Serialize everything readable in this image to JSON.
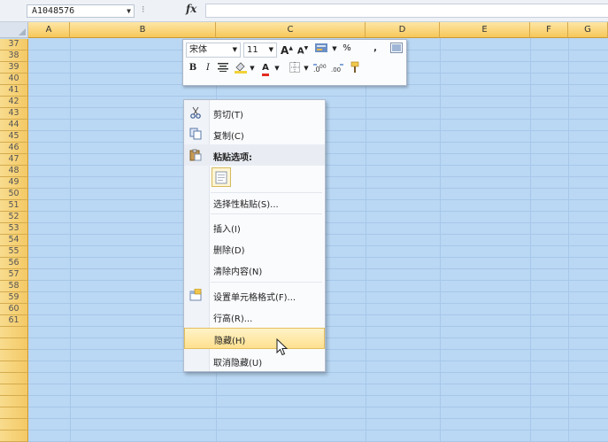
{
  "formula_bar": {
    "name_box": "A1048576",
    "fx_label": "fx",
    "formula": ""
  },
  "columns": [
    {
      "label": "A"
    },
    {
      "label": "B"
    },
    {
      "label": "C"
    },
    {
      "label": "D"
    },
    {
      "label": "E"
    },
    {
      "label": "F"
    },
    {
      "label": "G"
    }
  ],
  "rows": [
    "37",
    "38",
    "39",
    "40",
    "41",
    "42",
    "43",
    "44",
    "45",
    "46",
    "47",
    "48",
    "49",
    "50",
    "51",
    "52",
    "53",
    "54",
    "55",
    "56",
    "57",
    "58",
    "59",
    "60",
    "61"
  ],
  "mini_toolbar": {
    "font_name": "宋体",
    "font_size": "11",
    "grow_font": "A",
    "shrink_font": "A",
    "percent": "%",
    "comma": ",",
    "bold": "B",
    "italic": "I",
    "font_color": "A"
  },
  "context_menu": {
    "cut": "剪切(T)",
    "copy": "复制(C)",
    "paste_options": "粘贴选项:",
    "paste_special": "选择性粘贴(S)...",
    "insert": "插入(I)",
    "delete": "删除(D)",
    "clear_contents": "清除内容(N)",
    "format_cells": "设置单元格格式(F)...",
    "row_height": "行高(R)...",
    "hide": "隐藏(H)",
    "unhide": "取消隐藏(U)"
  },
  "colors": {
    "selection_fill": "#bad8f4",
    "header_active": "#f7c75a",
    "menu_highlight": "#ffe08f"
  }
}
